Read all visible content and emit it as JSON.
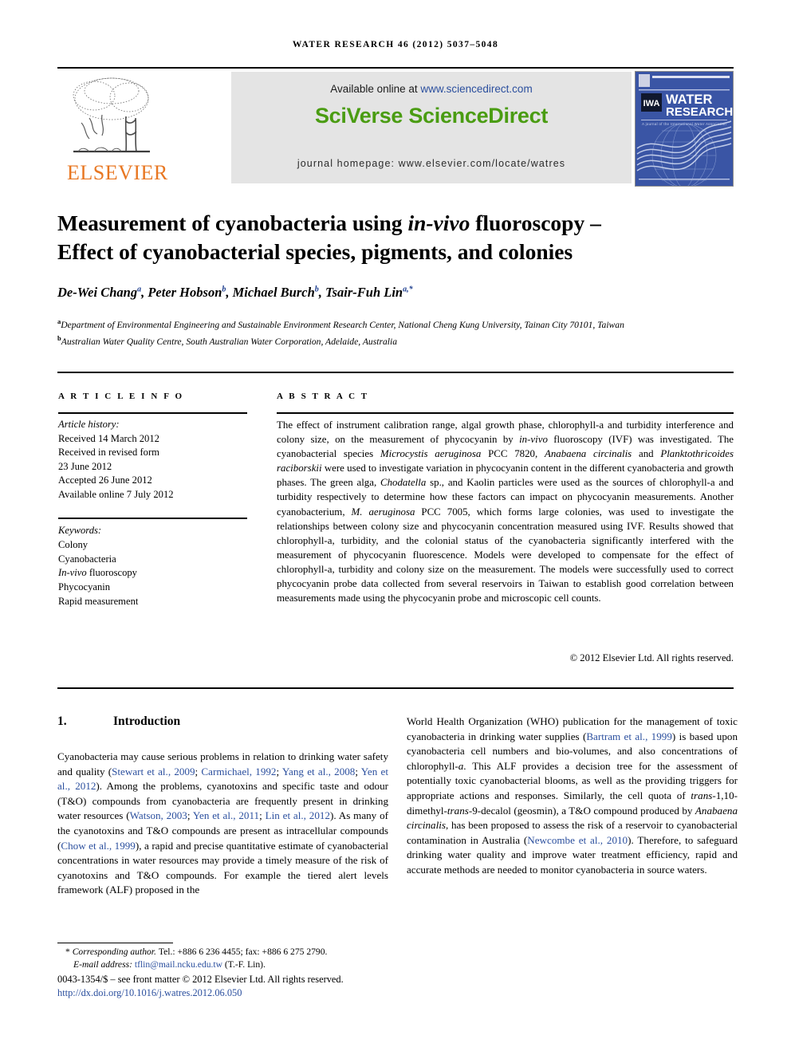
{
  "running_head": "WATER RESEARCH 46 (2012) 5037–5048",
  "masthead": {
    "available_prefix": "Available online at ",
    "available_url": "www.sciencedirect.com",
    "sciverse_title": "SciVerse ScienceDirect",
    "homepage": "journal homepage: www.elsevier.com/locate/watres",
    "elsevier_wordmark": "ELSEVIER",
    "cover_title_line1": "WATER",
    "cover_title_line2": "RESEARCH",
    "cover_iwa": "IWA",
    "cover_subtitle": "A journal of the International Water Association",
    "colors": {
      "sciverse_green": "#4a9c12",
      "link_blue": "#2b4f9e",
      "elsevier_orange": "#E87722",
      "cover_blue": "#3a55a5",
      "band_grey": "#e4e4e4"
    }
  },
  "title": {
    "line1_a": "Measurement of cyanobacteria using ",
    "line1_italic": "in-vivo",
    "line1_b": " fluoroscopy –",
    "line2": "Effect of cyanobacterial species, pigments, and colonies"
  },
  "authors": {
    "list": "De-Wei Chang a, Peter Hobson b, Michael Burch b, Tsair-Fuh Lin a,*",
    "names": [
      {
        "name": "De-Wei Chang",
        "sup": "a"
      },
      {
        "name": "Peter Hobson",
        "sup": "b"
      },
      {
        "name": "Michael Burch",
        "sup": "b"
      },
      {
        "name": "Tsair-Fuh Lin",
        "sup": "a,*"
      }
    ],
    "affiliations": [
      {
        "marker": "a",
        "text": "Department of Environmental Engineering and Sustainable Environment Research Center, National Cheng Kung University, Tainan City 70101, Taiwan"
      },
      {
        "marker": "b",
        "text": "Australian Water Quality Centre, South Australian Water Corporation, Adelaide, Australia"
      }
    ]
  },
  "article_info": {
    "heading": "A R T I C L E  I N F O",
    "history_label": "Article history:",
    "history": [
      "Received 14 March 2012",
      "Received in revised form",
      "23 June 2012",
      "Accepted 26 June 2012",
      "Available online 7 July 2012"
    ],
    "keywords_label": "Keywords:",
    "keywords": [
      "Colony",
      "Cyanobacteria",
      "In-vivo fluoroscopy",
      "Phycocyanin",
      "Rapid measurement"
    ]
  },
  "abstract": {
    "heading": "A B S T R A C T",
    "copyright": "© 2012 Elsevier Ltd. All rights reserved.",
    "parts": [
      {
        "t": "The effect of instrument calibration range, algal growth phase, chlorophyll-a and turbidity interference and colony size, on the measurement of phycocyanin by "
      },
      {
        "t": "in-vivo",
        "i": true
      },
      {
        "t": " fluoroscopy (IVF) was investigated. The cyanobacterial species "
      },
      {
        "t": "Microcystis aeruginosa",
        "i": true
      },
      {
        "t": " PCC 7820, "
      },
      {
        "t": "Anabaena circinalis",
        "i": true
      },
      {
        "t": " and "
      },
      {
        "t": "Planktothricoides raciborskii",
        "i": true
      },
      {
        "t": " were used to investigate variation in phycocyanin content in the different cyanobacteria and growth phases. The green alga, "
      },
      {
        "t": "Chodatella",
        "i": true
      },
      {
        "t": " sp., and Kaolin particles were used as the sources of chlorophyll-a and turbidity respectively to determine how these factors can impact on phycocyanin measurements. Another cyanobacterium, "
      },
      {
        "t": "M. aeruginosa",
        "i": true
      },
      {
        "t": " PCC 7005, which forms large colonies, was used to investigate the relationships between colony size and phycocyanin concentration measured using IVF. Results showed that chlorophyll-a, turbidity, and the colonial status of the cyanobacteria significantly interfered with the measurement of phycocyanin fluorescence. Models were developed to compensate for the effect of chlorophyll-a, turbidity and colony size on the measurement. The models were successfully used to correct phycocyanin probe data collected from several reservoirs in Taiwan to establish good correlation between measurements made using the phycocyanin probe and microscopic cell counts."
      }
    ]
  },
  "body": {
    "section_number": "1.",
    "section_title": "Introduction",
    "left_column": [
      {
        "t": "Cyanobacteria may cause serious problems in relation to drinking water safety and quality ("
      },
      {
        "t": "Stewart et al., 2009",
        "c": true
      },
      {
        "t": "; "
      },
      {
        "t": "Carmichael, 1992",
        "c": true
      },
      {
        "t": "; "
      },
      {
        "t": "Yang et al., 2008",
        "c": true
      },
      {
        "t": "; "
      },
      {
        "t": "Yen et al., 2012",
        "c": true
      },
      {
        "t": "). Among the problems, cyanotoxins and specific taste and odour (T&O) compounds from cyanobacteria are frequently present in drinking water resources ("
      },
      {
        "t": "Watson, 2003",
        "c": true
      },
      {
        "t": "; "
      },
      {
        "t": "Yen et al., 2011",
        "c": true
      },
      {
        "t": "; "
      },
      {
        "t": "Lin et al., 2012",
        "c": true
      },
      {
        "t": "). As many of the cyanotoxins and T&O compounds are present as intracellular compounds ("
      },
      {
        "t": "Chow et al., 1999",
        "c": true
      },
      {
        "t": "), a rapid and precise quantitative estimate of cyanobacterial concentrations in water resources may provide a timely measure of the risk of cyanotoxins and T&O compounds. For example the tiered alert levels framework (ALF) proposed in the"
      }
    ],
    "right_column": [
      {
        "t": "World Health Organization (WHO) publication for the management of toxic cyanobacteria in drinking water supplies ("
      },
      {
        "t": "Bartram et al., 1999",
        "c": true
      },
      {
        "t": ") is based upon cyanobacteria cell numbers and bio-volumes, and also concentrations of chlorophyll-"
      },
      {
        "t": "a",
        "i": true
      },
      {
        "t": ". This ALF provides a decision tree for the assessment of potentially toxic cyanobacterial blooms, as well as the providing triggers for appropriate actions and responses. Similarly, the cell quota of "
      },
      {
        "t": "trans",
        "i": true
      },
      {
        "t": "-1,10-dimethyl-"
      },
      {
        "t": "trans",
        "i": true
      },
      {
        "t": "-9-decalol (geosmin), a T&O compound produced by "
      },
      {
        "t": "Anabaena circinalis",
        "i": true
      },
      {
        "t": ", has been proposed to assess the risk of a reservoir to cyanobacterial contamination in Australia ("
      },
      {
        "t": "Newcombe et al., 2010",
        "c": true
      },
      {
        "t": "). Therefore, to safeguard drinking water quality and improve water treatment efficiency, rapid and accurate methods are needed to monitor cyanobacteria in source waters."
      }
    ]
  },
  "footer": {
    "corresponding_marker": "*",
    "corresponding_label": "Corresponding author.",
    "tel": "Tel.: +886 6 236 4455; fax: +886 6 275 2790.",
    "email_label": "E-mail address:",
    "email": "tflin@mail.ncku.edu.tw",
    "email_attrib": "(T.-F. Lin).",
    "frontmatter": "0043-1354/$ – see front matter © 2012 Elsevier Ltd. All rights reserved.",
    "doi": "http://dx.doi.org/10.1016/j.watres.2012.06.050"
  }
}
